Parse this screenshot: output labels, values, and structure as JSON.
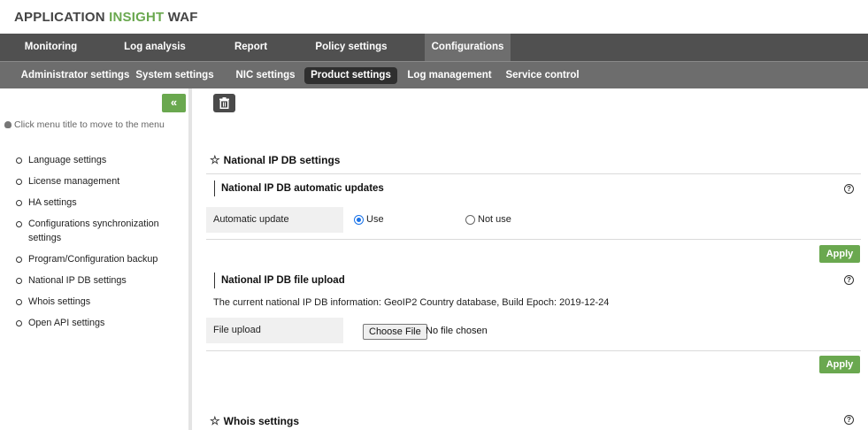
{
  "brand": {
    "part1": "APPLICATION ",
    "part2": "INSIGHT",
    "part3": " WAF"
  },
  "menu": [
    {
      "label": "Monitoring"
    },
    {
      "label": "Log analysis"
    },
    {
      "label": "Report"
    },
    {
      "label": "Policy settings"
    },
    {
      "label": "Configurations",
      "active": true
    }
  ],
  "submenu": [
    {
      "label": "Administrator settings"
    },
    {
      "label": "System settings"
    },
    {
      "label": "NIC settings"
    },
    {
      "label": "Product settings",
      "active": true
    },
    {
      "label": "Log management"
    },
    {
      "label": "Service control"
    }
  ],
  "sidebar": {
    "collapse_label": "«",
    "hint": "Click menu title to move to the menu",
    "items": [
      "Language settings",
      "License management",
      "HA settings",
      "Configurations synchronization settings",
      "Program/Configuration backup",
      "National IP DB settings",
      "Whois settings",
      "Open API settings"
    ]
  },
  "main": {
    "national_title": "National IP DB settings",
    "auto_update": {
      "title": "National IP DB automatic updates",
      "label": "Automatic update",
      "option_use": "Use",
      "option_not_use": "Not use",
      "selected": "Use"
    },
    "apply_label": "Apply",
    "file_upload": {
      "title": "National IP DB file upload",
      "info": "The current national IP DB information: GeoIP2 Country database, Build Epoch: 2019-12-24",
      "label": "File upload",
      "button": "Choose File",
      "status": "No file chosen"
    },
    "whois_title": "Whois settings",
    "help_glyph": "?"
  },
  "colors": {
    "accent": "#6aa84f",
    "menu_bg": "#505050",
    "submenu_bg": "#6d6d6d"
  }
}
